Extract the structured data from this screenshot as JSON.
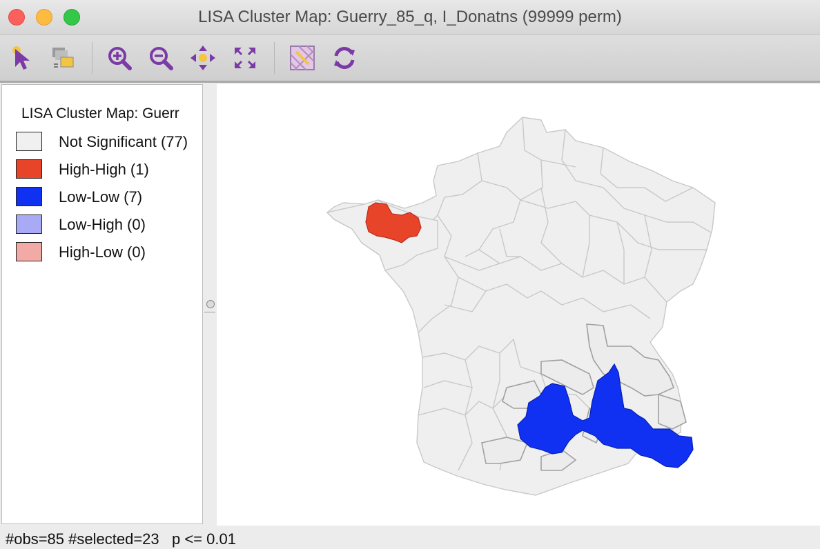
{
  "window": {
    "title": "LISA Cluster Map: Guerry_85_q, I_Donatns (99999 perm)"
  },
  "toolbar": {
    "tools": [
      {
        "name": "select-tool",
        "icon": "pointer-icon"
      },
      {
        "name": "selection-settings-tool",
        "icon": "select-mode-icon"
      },
      {
        "name": "zoom-in-tool",
        "icon": "zoom-in-icon"
      },
      {
        "name": "zoom-out-tool",
        "icon": "zoom-out-icon"
      },
      {
        "name": "pan-tool",
        "icon": "pan-icon"
      },
      {
        "name": "fit-extent-tool",
        "icon": "fit-to-window-icon"
      },
      {
        "name": "basemap-tool",
        "icon": "basemap-icon"
      },
      {
        "name": "refresh-tool",
        "icon": "refresh-icon"
      }
    ],
    "accent": "#7b3aa6"
  },
  "legend": {
    "title": "LISA Cluster Map: Guerr",
    "items": [
      {
        "label": "Not Significant (77)",
        "color": "#f0f0f0"
      },
      {
        "label": "High-High (1)",
        "color": "#e8442a"
      },
      {
        "label": "Low-Low (7)",
        "color": "#1031f2"
      },
      {
        "label": "Low-High (0)",
        "color": "#a8aaf5"
      },
      {
        "label": "High-Low (0)",
        "color": "#f2aaa6"
      }
    ]
  },
  "map": {
    "colors": {
      "not_significant": "#efefef",
      "high_high": "#e8442a",
      "low_low": "#1031f2",
      "outline": "#c8c8c8",
      "selected_outline": "#a0a0a0"
    }
  },
  "status": {
    "text": "#obs=85 #selected=23   p <= 0.01"
  }
}
